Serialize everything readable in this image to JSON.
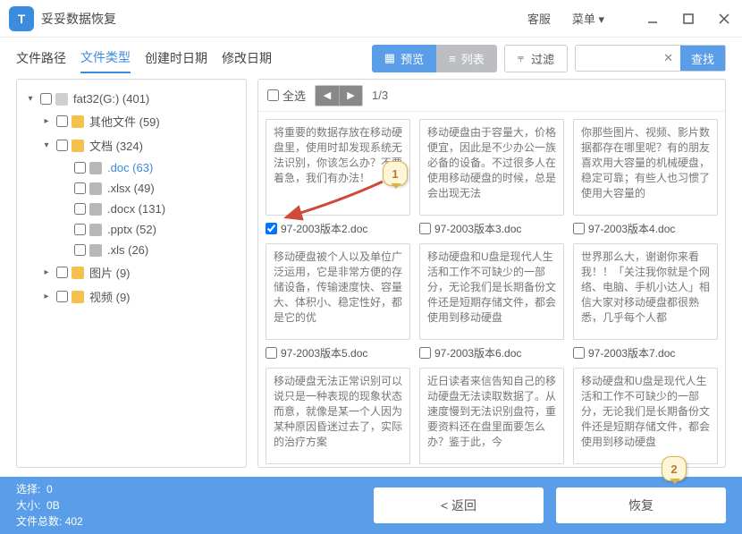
{
  "app": {
    "title": "妥妥数据恢复"
  },
  "titlebar": {
    "service": "客服",
    "menu": "菜单"
  },
  "tabs": {
    "path": "文件路径",
    "type": "文件类型",
    "created": "创建时日期",
    "modified": "修改日期"
  },
  "view": {
    "preview": "预览",
    "list": "列表",
    "filter": "过滤",
    "search": "查找"
  },
  "content_top": {
    "select_all": "全选",
    "page": "1/3"
  },
  "tree": {
    "root": "fat32(G:)  (401)",
    "other": "其他文件  (59)",
    "docs": "文档  (324)",
    "doc": ".doc  (63)",
    "xlsx": ".xlsx  (49)",
    "docx": ".docx  (131)",
    "pptx": ".pptx  (52)",
    "xls": ".xls  (26)",
    "pics": "图片  (9)",
    "video": "视频  (9)"
  },
  "thumbs": [
    {
      "text": "将重要的数据存放在移动硬盘里，使用时却发现系统无法识别，你该怎么办？不要着急，我们有办法！",
      "name": "97-2003版本2.doc"
    },
    {
      "text": "移动硬盘由于容量大，价格便宜，因此是不少办公一族必备的设备。不过很多人在使用移动硬盘的时候，总是会出现无法",
      "name": "97-2003版本3.doc"
    },
    {
      "text": "你那些图片、视频、影片数据都存在哪里呢？有的朋友喜欢用大容量的机械硬盘，稳定可靠；有些人也习惯了使用大容量的",
      "name": "97-2003版本4.doc"
    },
    {
      "text": "移动硬盘被个人以及单位广泛运用，它是非常方便的存储设备，传输速度快、容量大、体积小、稳定性好，都是它的优",
      "name": "97-2003版本5.doc"
    },
    {
      "text": "移动硬盘和U盘是现代人生活和工作不可缺少的一部分，无论我们是长期备份文件还是短期存储文件，都会使用到移动硬盘",
      "name": "97-2003版本6.doc"
    },
    {
      "text": "世界那么大，谢谢你来看我！！「关注我你就是个网络、电脑、手机小达人」相信大家对移动硬盘都很熟悉，几乎每个人都",
      "name": "97-2003版本7.doc"
    },
    {
      "text": "移动硬盘无法正常识别可以说只是一种表现的现象状态而意，就像是某一个人因为某种原因昏迷过去了，实际的治疗方案",
      "name": ""
    },
    {
      "text": "近日读者来信告知自己的移动硬盘无法读取数据了。从速度慢到无法识别盘符，重要资料还在盘里面要怎么办？鉴于此，今",
      "name": ""
    },
    {
      "text": "移动硬盘和U盘是现代人生活和工作不可缺少的一部分，无论我们是长期备份文件还是短期存储文件，都会使用到移动硬盘",
      "name": ""
    }
  ],
  "footer": {
    "selected_label": "选择:",
    "selected_val": "0",
    "size_label": "大小:",
    "size_val": "0B",
    "total_label": "文件总数:",
    "total_val": "402",
    "back": "<  返回",
    "recover": "恢复"
  },
  "callouts": {
    "c1": "1",
    "c2": "2"
  }
}
